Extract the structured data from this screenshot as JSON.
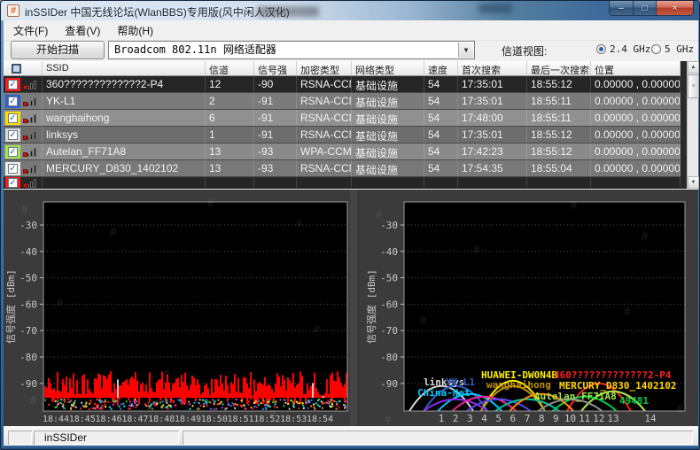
{
  "window": {
    "title": "inSSIDer 中国无线论坛(WlanBBS)专用版(风中闲人汉化)",
    "icon_glyph": "#",
    "controls": {
      "minimize": "–",
      "maximize": "□",
      "close": "×"
    }
  },
  "menu": {
    "items": [
      {
        "label": "文件(F)"
      },
      {
        "label": "查看(V)"
      },
      {
        "label": "帮助(H)"
      }
    ]
  },
  "toolbar": {
    "scan_button": "开始扫描",
    "adapter_selected": "Broadcom 802.11n 网络适配器",
    "combo_arrow": "▼",
    "channel_view_label": "信道视图:",
    "bands": [
      {
        "label": "2.4 GHz",
        "selected": true
      },
      {
        "label": "5 GHz",
        "selected": false
      }
    ]
  },
  "table": {
    "headers": [
      "SSID",
      "信道",
      "信号强",
      "加密类型",
      "网络类型",
      "速度",
      "首次搜索",
      "最后一次搜索",
      "位置"
    ],
    "check_glyph": "✓",
    "rows": [
      {
        "checked": true,
        "color": "#ff1a1a",
        "selected": true,
        "partial": false,
        "ssid": "360?????????????2-P4",
        "channel": "12",
        "rssi": "-90",
        "security": "RSNA-CCMP",
        "network_type": "基础设施",
        "speed": "54",
        "first_seen": "17:35:01",
        "last_seen": "18:55:12",
        "position": "0.00000 , 0.00000"
      },
      {
        "checked": true,
        "color": "#2f5fd0",
        "selected": false,
        "partial": false,
        "ssid": "YK-L1",
        "channel": "2",
        "rssi": "-91",
        "security": "RSNA-CCMP",
        "network_type": "基础设施",
        "speed": "54",
        "first_seen": "17:35:01",
        "last_seen": "18:55:11",
        "position": "0.00000 , 0.00000"
      },
      {
        "checked": true,
        "color": "#ffdf00",
        "selected": false,
        "partial": false,
        "ssid": "wanghaihong",
        "channel": "6",
        "rssi": "-91",
        "security": "RSNA-CCMP",
        "network_type": "基础设施",
        "speed": "54",
        "first_seen": "17:48:00",
        "last_seen": "18:55:11",
        "position": "0.00000 , 0.00000"
      },
      {
        "checked": true,
        "color": "#d9d9d9",
        "selected": false,
        "partial": false,
        "ssid": "linksys",
        "channel": "1",
        "rssi": "-91",
        "security": "RSNA-CCMP",
        "network_type": "基础设施",
        "speed": "54",
        "first_seen": "17:35:01",
        "last_seen": "18:55:12",
        "position": "0.00000 , 0.00000"
      },
      {
        "checked": true,
        "color": "#a6e34d",
        "selected": false,
        "partial": false,
        "ssid": "Autelan_FF71A8",
        "channel": "13",
        "rssi": "-93",
        "security": "WPA-CCMP",
        "network_type": "基础设施",
        "speed": "54",
        "first_seen": "17:42:23",
        "last_seen": "18:55:12",
        "position": "0.00000 , 0.00000"
      },
      {
        "checked": true,
        "color": "#ededed",
        "selected": false,
        "partial": false,
        "ssid": "MERCURY_D830_1402102",
        "channel": "13",
        "rssi": "-93",
        "security": "RSNA-CCMP",
        "network_type": "基础设施",
        "speed": "54",
        "first_seen": "17:54:35",
        "last_seen": "18:55:04",
        "position": "0.00000 , 0.00000"
      },
      {
        "checked": true,
        "color": "#ff1a1a",
        "selected": true,
        "partial": true,
        "ssid": "",
        "channel": "",
        "rssi": "",
        "security": "",
        "network_type": "",
        "speed": "",
        "first_seen": "",
        "last_seen": "",
        "position": ""
      }
    ]
  },
  "status": {
    "left": "inSSIDer"
  },
  "chart_data": [
    {
      "type": "line",
      "panel": "time-graph",
      "ylabel": "信号强度 [dBm]",
      "ylim": [
        -100,
        -20
      ],
      "yticks": [
        -30,
        -40,
        -50,
        -60,
        -70,
        -80,
        -90
      ],
      "xticks": [
        "18:44",
        "18:45",
        "18:46",
        "18:47",
        "18:48",
        "18:49",
        "18:50",
        "18:51",
        "18:52",
        "18:53",
        "18:54"
      ],
      "grid": true,
      "series": [
        {
          "name": "ambient-noise-band",
          "color": "#ff0000",
          "description": "dense red noise band fluctuating between about -86 and -93 dBm across the entire visible time range, with scattered multicolor specks below -92 dBm"
        }
      ]
    },
    {
      "type": "area",
      "panel": "channel-graph-2.4GHz",
      "ylabel": "信号强度 [dBm]",
      "ylim": [
        -100,
        -20
      ],
      "yticks": [
        -30,
        -40,
        -50,
        -60,
        -70,
        -80,
        -90
      ],
      "xticks": [
        1,
        2,
        3,
        4,
        5,
        6,
        7,
        8,
        9,
        10,
        11,
        12,
        13,
        14
      ],
      "series": [
        {
          "name": "linksys",
          "channel": 1,
          "rssi": -91,
          "color": "#d8d8d8",
          "labeled": true
        },
        {
          "name": "YK-L1",
          "channel": 2,
          "rssi": -91,
          "color": "#2f5fd0",
          "labeled": true
        },
        {
          "name": "China-Net",
          "channel": 3,
          "rssi": -94,
          "color": "#00c8ff",
          "labeled": true
        },
        {
          "name": "HUAWEI-DW0N4B",
          "channel": 6,
          "rssi": -89,
          "color": "#ffee00",
          "labeled": true
        },
        {
          "name": "wanghaihong",
          "channel": 6,
          "rssi": -91,
          "color": "#c39200",
          "labeled": true
        },
        {
          "name": "360?????????????2-P4",
          "channel": 12,
          "rssi": -90,
          "color": "#ff2222",
          "labeled": true
        },
        {
          "name": "MERCURY_D830_1402102",
          "channel": 13,
          "rssi": -93,
          "color": "#ffd700",
          "labeled": true
        },
        {
          "name": "Autelan_FF71A8",
          "channel": 13,
          "rssi": -93,
          "color": "#a6e34d",
          "labeled": true
        },
        {
          "name": "49481",
          "channel": 11,
          "rssi": -95,
          "color": "#00cc44",
          "labeled": true
        },
        {
          "name": "",
          "channel": 2,
          "rssi": -96,
          "color": "#8a2be2",
          "labeled": false
        },
        {
          "name": "",
          "channel": 4,
          "rssi": -95,
          "color": "#e8239a",
          "labeled": false
        },
        {
          "name": "",
          "channel": 5,
          "rssi": -96,
          "color": "#5544ee",
          "labeled": false
        },
        {
          "name": "",
          "channel": 7,
          "rssi": -96,
          "color": "#00bfa0",
          "labeled": false
        },
        {
          "name": "",
          "channel": 8,
          "rssi": -94,
          "color": "#ff8800",
          "labeled": false
        },
        {
          "name": "",
          "channel": 10,
          "rssi": -96,
          "color": "#909090",
          "labeled": false
        }
      ]
    }
  ]
}
